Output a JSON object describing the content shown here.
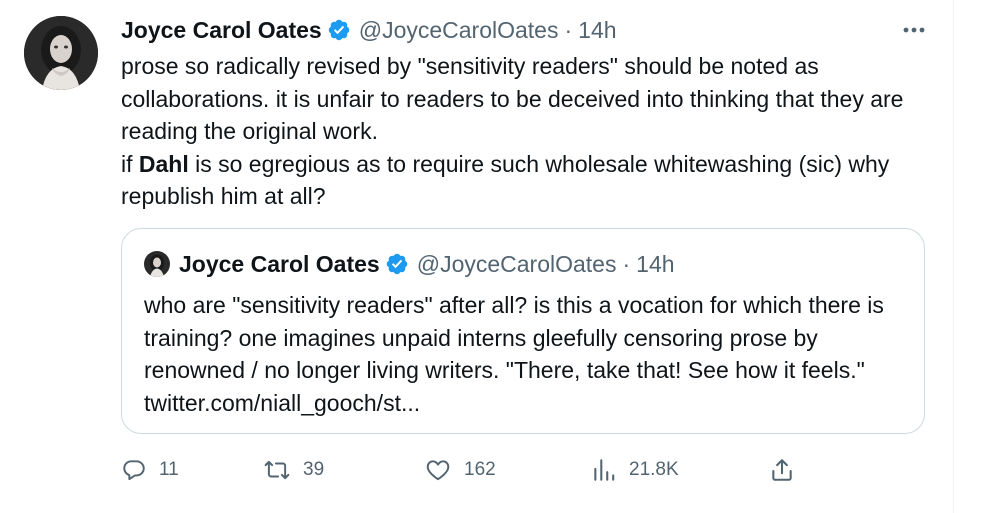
{
  "tweet": {
    "author_name": "Joyce Carol Oates",
    "handle": "@JoyceCarolOates",
    "separator": "·",
    "time": "14h",
    "text_line1": "prose so radically revised by \"sensitivity readers\" should be noted as collaborations. it is unfair to readers to be deceived into thinking that they are reading the original work.",
    "text_line2_before": "if ",
    "text_line2_bold": "Dahl",
    "text_line2_after": " is so egregious as to require such wholesale whitewashing (sic) why republish him at all?"
  },
  "quoted_tweet": {
    "author_name": "Joyce Carol Oates",
    "handle": "@JoyceCarolOates",
    "separator": "·",
    "time": "14h",
    "text": "who are \"sensitivity readers\" after all? is this a vocation for which there is training? one imagines unpaid interns gleefully censoring prose by renowned / no longer living writers.  \"There, take that!  See how it feels.\" twitter.com/niall_gooch/st..."
  },
  "actions": {
    "replies": "11",
    "retweets": "39",
    "likes": "162",
    "views": "21.8K"
  },
  "colors": {
    "text": "#0f1419",
    "secondary": "#536471",
    "verified_blue": "#1d9bf0",
    "border": "#cfd9de"
  },
  "icons": [
    "verified-badge-icon",
    "more-icon",
    "reply-icon",
    "retweet-icon",
    "like-icon",
    "views-icon",
    "share-icon"
  ]
}
